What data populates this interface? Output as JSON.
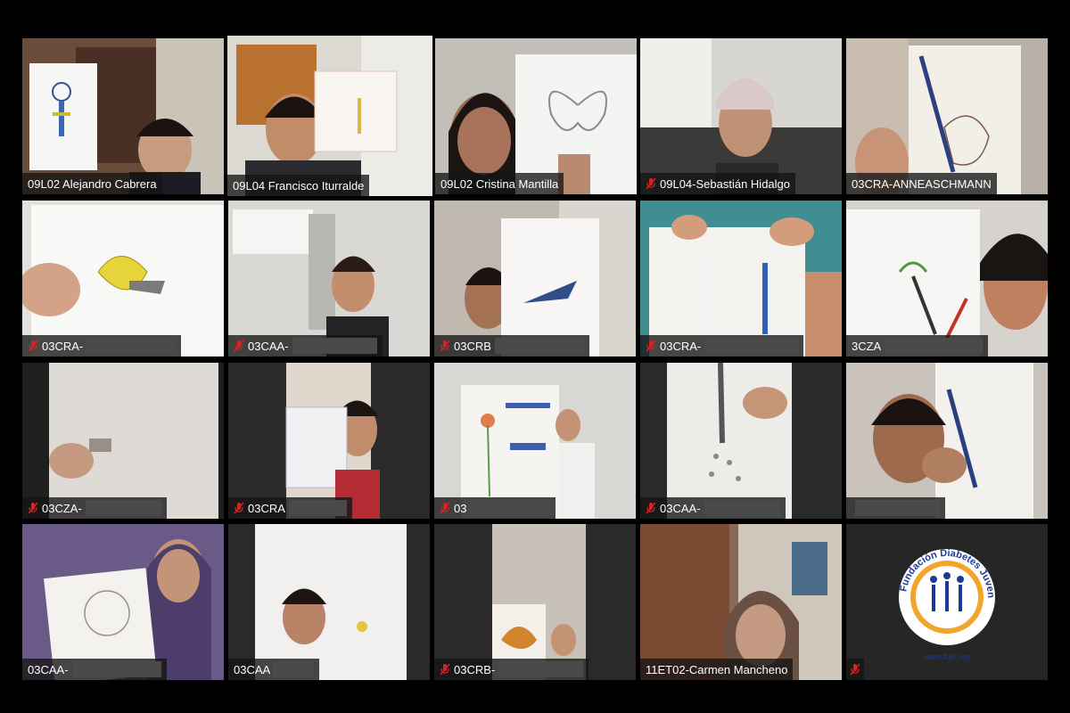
{
  "colors": {
    "background": "#000000",
    "active_speaker_border": "#d7e86a",
    "nameplate_bg": "rgba(20,20,20,0.78)",
    "mute_icon": "#e02020"
  },
  "tiles": [
    {
      "name": "09L02 Alejandro Cabrera",
      "muted": false
    },
    {
      "name": "09L04 Francisco Iturralde",
      "muted": false,
      "active": true
    },
    {
      "name": "09L02 Cristina Mantilla",
      "muted": false
    },
    {
      "name": "09L04-Sebastián Hidalgo",
      "muted": true
    },
    {
      "name": "03CRA-ANNEASCHMANN",
      "muted": false
    },
    {
      "name": "03CRA-",
      "muted": true
    },
    {
      "name": "03CAA-",
      "muted": true
    },
    {
      "name": "03CRB",
      "muted": true
    },
    {
      "name": "03CRA-",
      "muted": true
    },
    {
      "name": "3CZA",
      "muted": false
    },
    {
      "name": "03CZA-",
      "muted": true
    },
    {
      "name": "03CRA",
      "muted": true
    },
    {
      "name": "03",
      "muted": true
    },
    {
      "name": "03CAA-",
      "muted": true
    },
    {
      "name": "",
      "muted": false
    },
    {
      "name": "03CAA-",
      "muted": false
    },
    {
      "name": "03CAA",
      "muted": false
    },
    {
      "name": "03CRB-",
      "muted": true
    },
    {
      "name": "11ET02-Carmen Mancheno",
      "muted": false
    },
    {
      "name": "",
      "muted": true,
      "logo": true
    }
  ],
  "logo": {
    "text_ring": "Fundación Diabetes Juvenil Ecuador",
    "url": "www.fdje.org",
    "ring_color": "#f2a52b",
    "text_color": "#1a3a9a"
  }
}
